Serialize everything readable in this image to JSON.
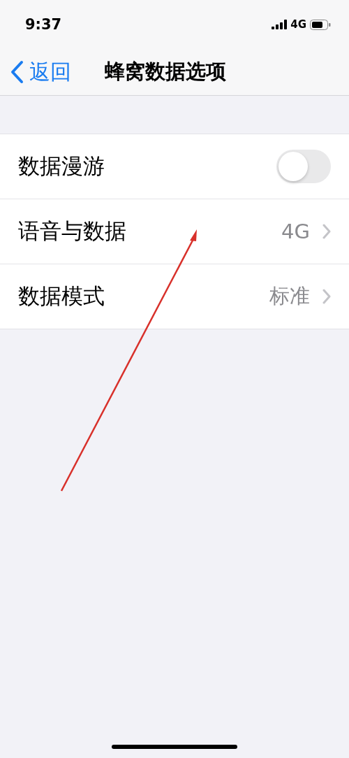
{
  "status_bar": {
    "time": "9:37",
    "network": "4G"
  },
  "nav": {
    "back": "返回",
    "title": "蜂窝数据选项"
  },
  "rows": [
    {
      "kind": "toggle",
      "label": "数据漫游",
      "on": false
    },
    {
      "kind": "value",
      "label": "语音与数据",
      "value": "4G"
    },
    {
      "kind": "value",
      "label": "数据模式",
      "value": "标准"
    }
  ]
}
